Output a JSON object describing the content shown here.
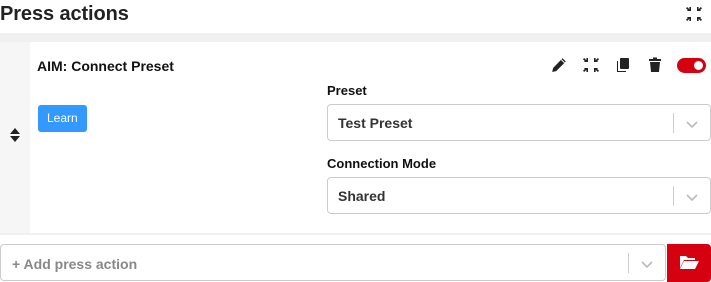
{
  "header": {
    "title": "Press actions",
    "collapse_icon": "compress-icon"
  },
  "action": {
    "name": "AIM: Connect Preset",
    "learn_label": "Learn",
    "toolbar_icons": [
      "pencil-icon",
      "compress-icon",
      "copy-icon",
      "trash-icon",
      "toggle-switch"
    ],
    "enabled": true,
    "fields": [
      {
        "label": "Preset",
        "value": "Test Preset"
      },
      {
        "label": "Connection Mode",
        "value": "Shared"
      }
    ]
  },
  "add_action": {
    "placeholder": "+ Add press action",
    "folder_icon": "folder-open-icon"
  },
  "colors": {
    "accent_red": "#d50010",
    "learn_blue": "#3399ff",
    "panel_bg": "#f0f0f0"
  }
}
